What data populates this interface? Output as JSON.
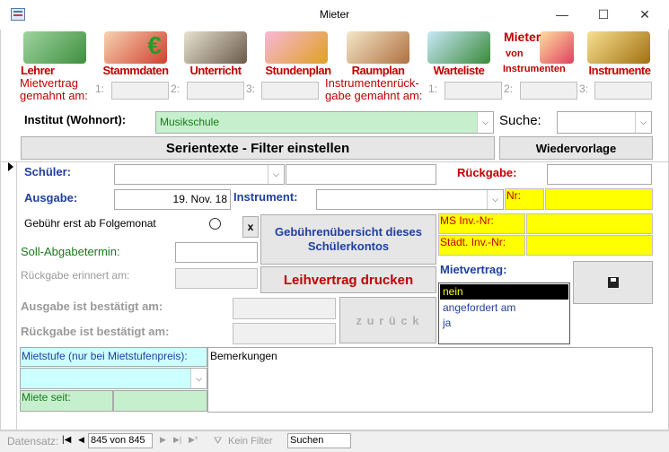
{
  "window": {
    "title": "Mieter",
    "min": "—",
    "max": "☐",
    "close": "✕"
  },
  "nav": [
    {
      "label": "Lehrer",
      "icon": "teacher-icon"
    },
    {
      "label": "Stammdaten",
      "icon": "house-euro-icon"
    },
    {
      "label": "Unterricht",
      "icon": "music-lesson-icon"
    },
    {
      "label": "Stundenplan",
      "icon": "schedule-icon"
    },
    {
      "label": "Raumplan",
      "icon": "room-plan-icon"
    },
    {
      "label": "Warteliste",
      "icon": "waiting-list-icon"
    },
    {
      "label": "Mieter von Instrumenten",
      "icon": "renter-icon",
      "line1": "Mieter",
      "line2": "von",
      "line3": "Instrumenten"
    },
    {
      "label": "Instrumente",
      "icon": "instruments-icon"
    }
  ],
  "mietvertrag_gemahnt": {
    "label": "Mietvertrag gemahnt am:",
    "n1": "1:",
    "n2": "2:",
    "n3": "3:"
  },
  "instrument_rueckgabe": {
    "label": "Instrumentenrück- gabe gemahnt am:",
    "n1": "1:",
    "n2": "2:",
    "n3": "3:"
  },
  "institut": {
    "label": "Institut (Wohnort):",
    "value": "Musikschule"
  },
  "suche": {
    "label": "Suche:",
    "value": ""
  },
  "buttons": {
    "serientexte": "Serientexte - Filter einstellen",
    "wiedervorlage": "Wiedervorlage",
    "gebuehren": "Gebührenübersicht dieses Schülerkontos",
    "leihvertrag": "Leihvertrag drucken",
    "zurueck": "z u r ü c k",
    "x": "x"
  },
  "form": {
    "schueler": "Schüler:",
    "rueckgabe": "Rückgabe:",
    "ausgabe": "Ausgabe:",
    "ausgabe_value": "19. Nov. 18",
    "instrument": "Instrument:",
    "nr": "Nr:",
    "gebuehr": "Gebühr erst ab Folgemonat",
    "ms_inv": "MS Inv.-Nr:",
    "staedt_inv": "Städt. Inv.-Nr:",
    "soll": "Soll-Abgabetermin:",
    "rueckgabe_erinnert": "Rückgabe erinnert am:",
    "mietvertrag": "Mietvertrag:",
    "mietvertrag_options": [
      "nein",
      "angefordert am",
      "ja"
    ],
    "ausgabe_bestaetigt": "Ausgabe ist bestätigt am:",
    "rueckgabe_bestaetigt": "Rückgabe ist bestätigt am:",
    "mietstufe": "Mietstufe (nur bei Mietstufenpreis):",
    "bemerkungen": "Bemerkungen",
    "miete_seit": "Miete seit:"
  },
  "statusbar": {
    "datensatz": "Datensatz:",
    "first": "|◀",
    "prev": "◀",
    "record": "845 von 845",
    "next": "▶",
    "last": "▶|",
    "new": "▶*",
    "filter": "Kein Filter",
    "search": "Suchen"
  },
  "colors": {
    "accent_red": "#c00000",
    "label_blue": "#1f3f9f",
    "label_green": "#1a7a1a",
    "field_yellow": "#ffff00",
    "field_green": "#c6efce",
    "field_cyan": "#ccffff"
  }
}
